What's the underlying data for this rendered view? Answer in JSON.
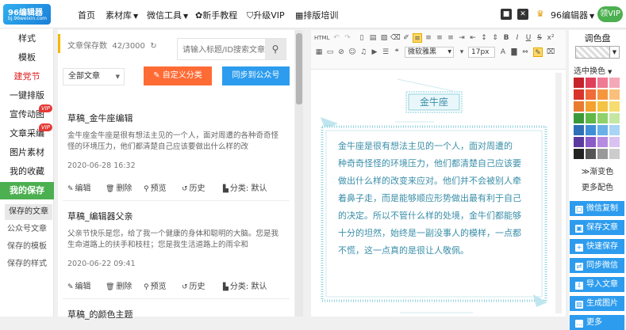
{
  "topbar": {
    "logo_main": "96编辑器",
    "logo_sub": "bj.96weixin.com",
    "nav": [
      {
        "label": "首页",
        "caret": false
      },
      {
        "label": "素材库",
        "caret": true
      },
      {
        "label": "微信工具",
        "caret": true
      },
      {
        "label": "新手教程",
        "caret": false
      },
      {
        "label": "升级VIP",
        "caret": false
      },
      {
        "label": "排版培训",
        "caret": false
      }
    ],
    "user_name": "96编辑器",
    "vip_button": "领VIP"
  },
  "sidebar": {
    "items": [
      {
        "label": "样式",
        "style": "normal",
        "vip": false
      },
      {
        "label": "模板",
        "style": "normal",
        "vip": false
      },
      {
        "label": "建党节",
        "style": "red",
        "vip": false
      },
      {
        "label": "一键排版",
        "style": "normal",
        "vip": false
      },
      {
        "label": "宣传动图",
        "style": "normal",
        "vip": true
      },
      {
        "label": "文章采编",
        "style": "normal",
        "vip": true
      },
      {
        "label": "图片素材",
        "style": "normal",
        "vip": false
      },
      {
        "label": "我的收藏",
        "style": "normal",
        "vip": false
      },
      {
        "label": "我的保存",
        "style": "active",
        "vip": false
      }
    ],
    "vip_badge": "VIP",
    "subitems": [
      "保存的文章",
      "公众号文章",
      "保存的模板",
      "保存的样式"
    ]
  },
  "panel": {
    "count_label": "文章保存数",
    "count_value": "42/3000",
    "search_placeholder": "请输入标题/ID搜索文章",
    "filter_value": "全部文章",
    "custom_category_button": "自定义分类",
    "sync_button": "同步到公众号",
    "articles": [
      {
        "title": "草稿_金牛座编辑",
        "excerpt": "金牛座金牛座是很有想法主见的一个人，面对周遭的各种奇奇怪怪的环境压力，他们都清楚自己应该要做出什么样的改",
        "date": "2020-06-28 16:32"
      },
      {
        "title": "草稿_编辑器父亲",
        "excerpt": "父亲节快乐是您，给了我一个健康的身体和聪明的大脑。您是我生命道路上的扶手和枝柱；您是我生活道路上的雨伞和",
        "date": "2020-06-22 09:41"
      },
      {
        "title": "草稿_的颜色主题",
        "excerpt": "",
        "date": ""
      }
    ],
    "actions": {
      "edit": "编辑",
      "delete": "删除",
      "preview": "预览",
      "history": "历史",
      "category": "分类: 默认"
    }
  },
  "editor": {
    "html_label": "HTML",
    "font_family": "微软雅黑",
    "font_size": "17px",
    "heading": "金牛座",
    "body": "金牛座是很有想法主见的一个人，面对周遭的各种奇怪怪的环境压力，他们都清楚自己应该要做出什么样的改变来应对。他们并不会被别人牵着鼻子走，而是能够顺应形势做出最有利于自己的决定。所以不管什么样的处境，金牛们都能够十分的坦然，始终是一副没事人的模样，一点都不慌，这一点真的是很让人敬佩。",
    "accent_color": "#8ed1de",
    "text_color": "#3a8ea8"
  },
  "right": {
    "title": "调色盘",
    "selected_label": "选中换色",
    "gradient_link": "渐变色",
    "more_colors_link": "更多配色",
    "swatches": [
      "#c6232c",
      "#e0415a",
      "#f07a93",
      "#f4a9b8",
      "#d9342b",
      "#f06a3a",
      "#f5963f",
      "#f9c07c",
      "#e87b2e",
      "#f4a12f",
      "#f5c342",
      "#f7dc6f",
      "#3a9a3a",
      "#5fb848",
      "#8fd16a",
      "#c4e7a4",
      "#2e6fb8",
      "#3f8fd8",
      "#6ab0e8",
      "#a8d4f5",
      "#5a3aa0",
      "#8a5ac8",
      "#b58ae0",
      "#d9c2f0",
      "#222222",
      "#555555",
      "#999999",
      "#cccccc"
    ],
    "actions": [
      "微信复制",
      "保存文章",
      "快速保存",
      "同步微信",
      "导入文章",
      "生成图片",
      "更多"
    ]
  }
}
